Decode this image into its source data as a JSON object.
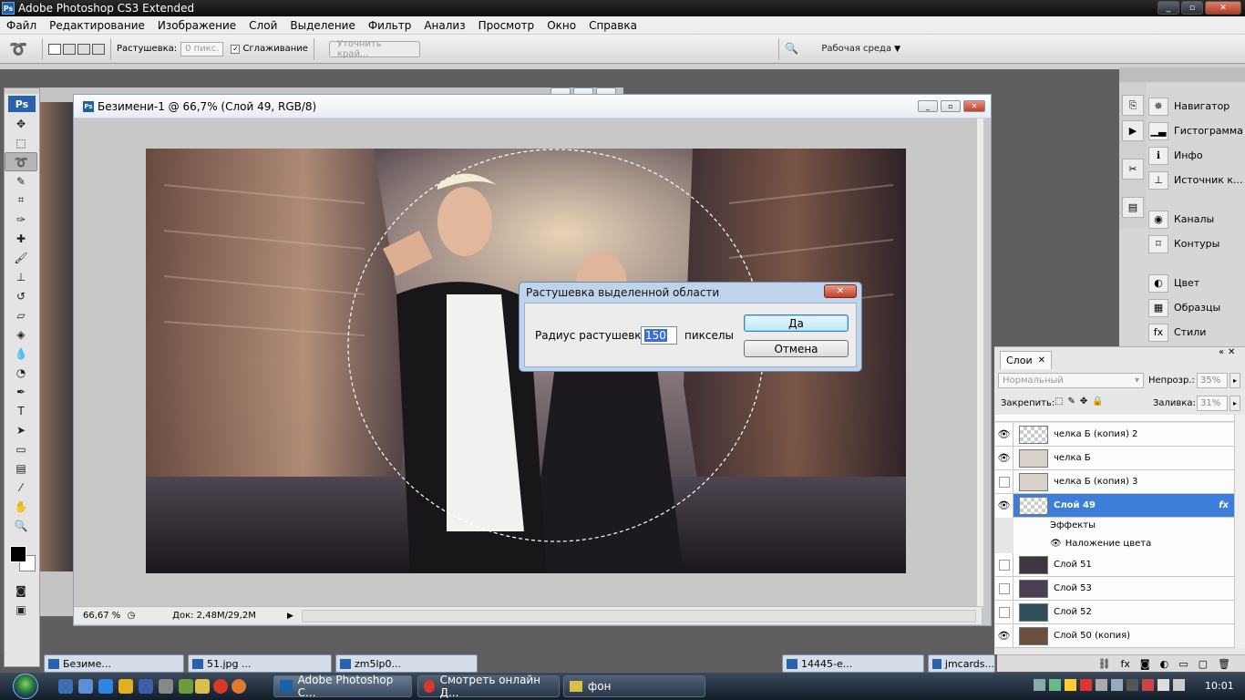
{
  "app": {
    "title": "Adobe Photoshop CS3 Extended"
  },
  "menu": [
    "Файл",
    "Редактирование",
    "Изображение",
    "Слой",
    "Выделение",
    "Фильтр",
    "Анализ",
    "Просмотр",
    "Окно",
    "Справка"
  ],
  "options": {
    "feather_label": "Растушевка:",
    "feather_value": "0 пикс.",
    "antialias_label": "Сглаживание",
    "refine_edge": "Уточнить край...",
    "workspace": "Рабочая среда"
  },
  "document": {
    "title": "Безимени-1 @ 66,7% (Слой 49, RGB/8)",
    "zoom": "66,67 %",
    "doc_info": "Док: 2,48M/29,2M"
  },
  "dialog": {
    "title": "Растушевка выделенной области",
    "radius_label": "Радиус растушевки:",
    "radius_value": "150",
    "units": "пикселы",
    "ok": "Да",
    "cancel": "Отмена"
  },
  "right_panels": [
    {
      "label": "Навигатор",
      "icon": "navigator-icon"
    },
    {
      "label": "Гистограмма",
      "icon": "histogram-icon"
    },
    {
      "label": "Инфо",
      "icon": "info-icon"
    },
    {
      "label": "Источник к...",
      "icon": "clone-source-icon"
    },
    {
      "label": "Каналы",
      "icon": "channels-icon"
    },
    {
      "label": "Контуры",
      "icon": "paths-icon"
    },
    {
      "label": "Цвет",
      "icon": "color-icon"
    },
    {
      "label": "Образцы",
      "icon": "swatches-icon"
    },
    {
      "label": "Стили",
      "icon": "styles-icon"
    }
  ],
  "layers_panel": {
    "tab": "Слои",
    "blend_mode": "Нормальный",
    "opacity_label": "Непрозр.:",
    "opacity": "35%",
    "lock_label": "Закрепить:",
    "fill_label": "Заливка:",
    "fill": "31%",
    "effects_label": "Эффекты",
    "effect_item": "Наложение цвета",
    "layers": [
      {
        "name": "челка Б (копия) 2",
        "visible": true
      },
      {
        "name": "челка Б",
        "visible": true
      },
      {
        "name": "челка Б (копия) 3",
        "visible": false
      },
      {
        "name": "Слой 49",
        "visible": true,
        "selected": true
      },
      {
        "name": "Слой 51",
        "visible": false
      },
      {
        "name": "Слой 53",
        "visible": false
      },
      {
        "name": "Слой 52",
        "visible": false
      },
      {
        "name": "Слой 50 (копия)",
        "visible": true
      }
    ]
  },
  "doc_tabs": [
    "Безиме...",
    "51.jpg ...",
    "zm5lp0...",
    "14445-e...",
    "jmcards..."
  ],
  "taskbar": {
    "items": [
      "Adobe Photoshop C...",
      "Смотреть онлайн Д...",
      "фон"
    ],
    "clock": "10:01"
  }
}
